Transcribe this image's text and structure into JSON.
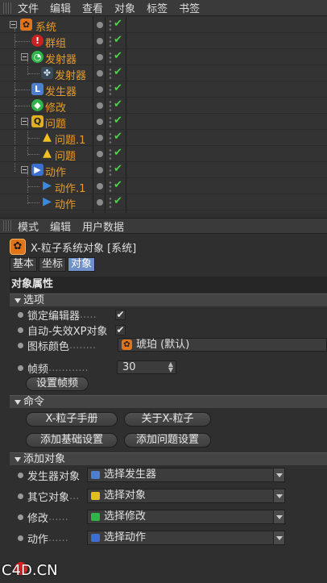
{
  "menubar": {
    "items": [
      "文件",
      "编辑",
      "查看",
      "对象",
      "标签",
      "书签"
    ]
  },
  "objects": [
    {
      "name": "系统",
      "icon": "orange-system-icon",
      "color": "#e07418"
    },
    {
      "name": "群组",
      "icon": "red-group-icon",
      "color": "#d22a2a"
    },
    {
      "name": "发射器",
      "icon": "green-emitter-icon",
      "color": "#2fb54a"
    },
    {
      "name": "发射器",
      "icon": "emitter-shape-icon",
      "color": "#8ab8d8"
    },
    {
      "name": "发生器",
      "icon": "blue-generator-icon",
      "color": "#4d7ed0"
    },
    {
      "name": "修改",
      "icon": "green-modifier-icon",
      "color": "#2fb54a"
    },
    {
      "name": "问题",
      "icon": "yellow-question-icon",
      "color": "#e0b020"
    },
    {
      "name": "问题.1",
      "icon": "warning-icon",
      "color": "#f0c020"
    },
    {
      "name": "问题",
      "icon": "warning-icon",
      "color": "#f0c020"
    },
    {
      "name": "动作",
      "icon": "blue-action-icon",
      "color": "#3b6fd1"
    },
    {
      "name": "动作.1",
      "icon": "play-icon",
      "color": "#3b8ae0"
    },
    {
      "name": "动作",
      "icon": "play-icon",
      "color": "#3b8ae0"
    }
  ],
  "attributes": {
    "menu": [
      "模式",
      "编辑",
      "用户数据"
    ],
    "object_title": "X-粒子系统对象 [系统]",
    "tabs": [
      "基本",
      "坐标",
      "对象"
    ],
    "section_title": "对象属性",
    "groups": {
      "options": "选项",
      "commands": "命令",
      "add_object": "添加对象"
    },
    "options": {
      "lock_editor_label": "锁定编辑器",
      "lock_editor_lead": " .....",
      "auto_disable_label": "自动-失效XP对象",
      "icon_color_label": "图标颜色",
      "icon_color_lead": " ........",
      "icon_color_value": "琥珀 (默认)",
      "frame_rate_label": "帧频",
      "frame_rate_lead": " ............",
      "frame_rate_value": "30",
      "set_frame_rate_button": "设置帧频"
    },
    "commands": {
      "manual_button": "X-粒子手册",
      "about_button": "关于X-粒子",
      "add_basic_button": "添加基础设置",
      "add_question_button": "添加问题设置"
    },
    "add_object": {
      "rows": [
        {
          "label": "发生器对象",
          "lead": "",
          "value": "选择发生器",
          "color": "#4d7ed0"
        },
        {
          "label": "其它对象",
          "lead": "...",
          "value": "选择对象",
          "color": "#e0c020"
        },
        {
          "label": "修改",
          "lead": " ......",
          "value": "选择修改",
          "color": "#2fb54a"
        },
        {
          "label": "动作",
          "lead": " ......",
          "value": "选择动作",
          "color": "#3b6fd1"
        }
      ]
    }
  },
  "watermark": "C4D.CN"
}
